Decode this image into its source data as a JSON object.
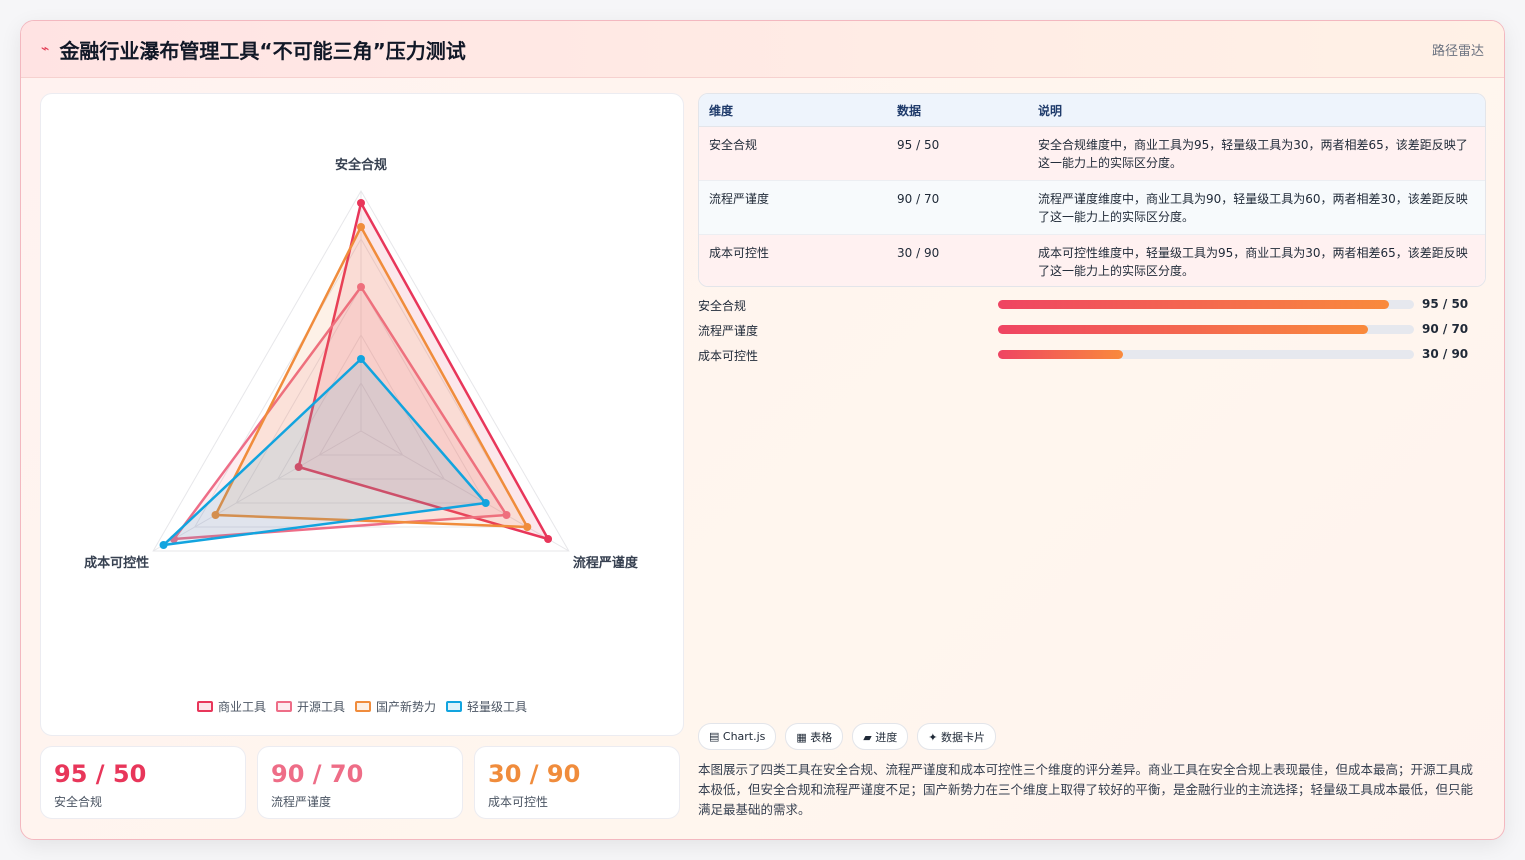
{
  "header": {
    "title": "金融行业瀑布管理工具“不可能三角”压力测试",
    "title_icon": "⌁",
    "right_label": "路径雷达"
  },
  "chart_data": {
    "type": "radar",
    "axes": [
      "安全合规",
      "流程严谨度",
      "成本可控性"
    ],
    "range": [
      0,
      100
    ],
    "series": [
      {
        "name": "商业工具",
        "values": [
          95,
          90,
          30
        ],
        "color": "#e8365a"
      },
      {
        "name": "开源工具",
        "values": [
          60,
          70,
          90
        ],
        "color": "#ee6d87"
      },
      {
        "name": "国产新势力",
        "values": [
          85,
          80,
          70
        ],
        "color": "#f08c3c"
      },
      {
        "name": "轻量级工具",
        "values": [
          30,
          60,
          95
        ],
        "color": "#12a4df"
      }
    ]
  },
  "table": {
    "headers": [
      "维度",
      "数据",
      "说明"
    ],
    "rows": [
      {
        "dim": "安全合规",
        "data": "95 / 50",
        "desc": "安全合规维度中，商业工具为95，轻量级工具为30，两者相差65，该差距反映了这一能力上的实际区分度。"
      },
      {
        "dim": "流程严谨度",
        "data": "90 / 70",
        "desc": "流程严谨度维度中，商业工具为90，轻量级工具为60，两者相差30，该差距反映了这一能力上的实际区分度。"
      },
      {
        "dim": "成本可控性",
        "data": "30 / 90",
        "desc": "成本可控性维度中，轻量级工具为95，商业工具为30，两者相差65，该差距反映了这一能力上的实际区分度。"
      }
    ]
  },
  "progress": [
    {
      "label": "安全合规",
      "value": "95 / 50",
      "fraction": 0.94
    },
    {
      "label": "流程严谨度",
      "value": "90 / 70",
      "fraction": 0.89
    },
    {
      "label": "成本可控性",
      "value": "30 / 90",
      "fraction": 0.3
    }
  ],
  "kpis": [
    {
      "value": "95 / 50",
      "label": "安全合规",
      "color": "#e8365a"
    },
    {
      "value": "90 / 70",
      "label": "流程严谨度",
      "color": "#ee6d87"
    },
    {
      "value": "30 / 90",
      "label": "成本可控性",
      "color": "#f08c3c"
    }
  ],
  "chips": [
    "▤ Chart.js",
    "▦ 表格",
    "▰ 进度",
    "✦ 数据卡片"
  ],
  "summary": "本图展示了四类工具在安全合规、流程严谨度和成本可控性三个维度的评分差异。商业工具在安全合规上表现最佳，但成本最高；开源工具成本极低，但安全合规和流程严谨度不足；国产新势力在三个维度上取得了较好的平衡，是金融行业的主流选择；轻量级工具成本最低，但只能满足最基础的需求。"
}
